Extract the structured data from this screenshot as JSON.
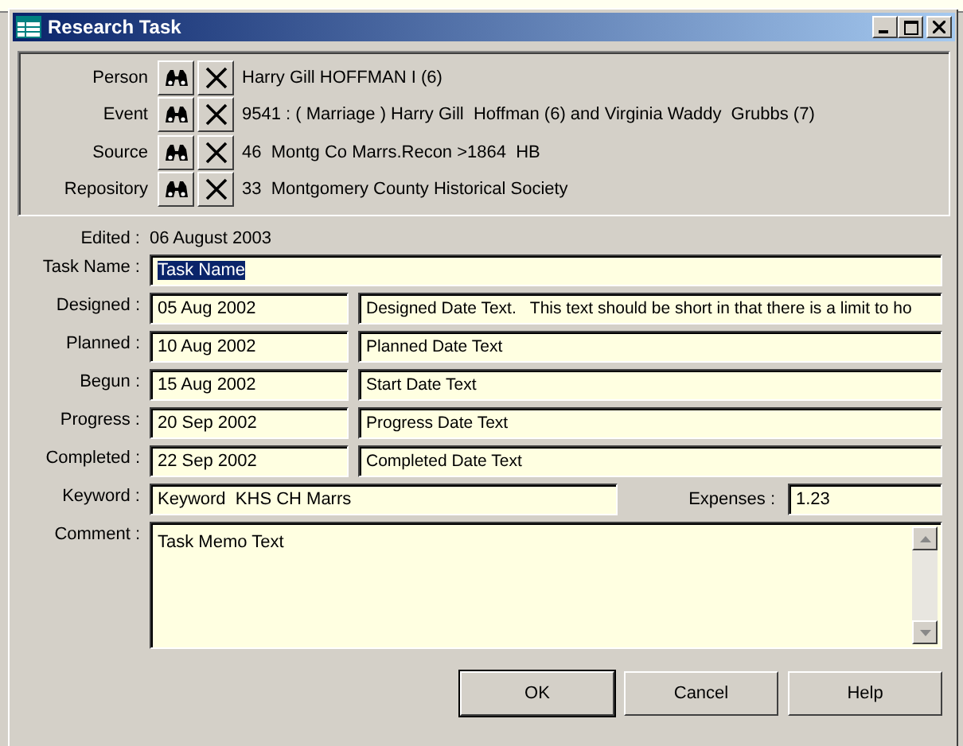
{
  "window": {
    "title": "Research Task"
  },
  "links": [
    {
      "label": "Person",
      "value": "Harry Gill HOFFMAN I (6)"
    },
    {
      "label": "Event",
      "value": "9541 : ( Marriage ) Harry Gill  Hoffman (6) and Virginia Waddy  Grubbs (7)"
    },
    {
      "label": "Source",
      "value": "46  Montg Co Marrs.Recon >1864  HB"
    },
    {
      "label": "Repository",
      "value": "33  Montgomery County Historical Society"
    }
  ],
  "edited": {
    "label": "Edited :",
    "value": "06 August 2003"
  },
  "task_name": {
    "label": "Task Name :",
    "value": "Task Name",
    "highlighted": true
  },
  "dates": [
    {
      "label": "Designed :",
      "date": "05 Aug 2002",
      "text": "Designed Date Text.   This text should be short in that there is a limit to ho"
    },
    {
      "label": "Planned :",
      "date": "10 Aug 2002",
      "text": "Planned Date Text"
    },
    {
      "label": "Begun :",
      "date": "15 Aug 2002",
      "text": "Start Date Text"
    },
    {
      "label": "Progress :",
      "date": "20 Sep 2002",
      "text": "Progress Date Text"
    },
    {
      "label": "Completed :",
      "date": "22 Sep 2002",
      "text": "Completed Date Text"
    }
  ],
  "keyword": {
    "label": "Keyword :",
    "value": "Keyword  KHS CH Marrs"
  },
  "expenses": {
    "label": "Expenses :",
    "value": "1.23"
  },
  "comment": {
    "label": "Comment :",
    "value": "Task Memo Text"
  },
  "buttons": [
    {
      "label": "OK",
      "default": true
    },
    {
      "label": "Cancel",
      "default": false
    },
    {
      "label": "Help",
      "default": false
    }
  ]
}
